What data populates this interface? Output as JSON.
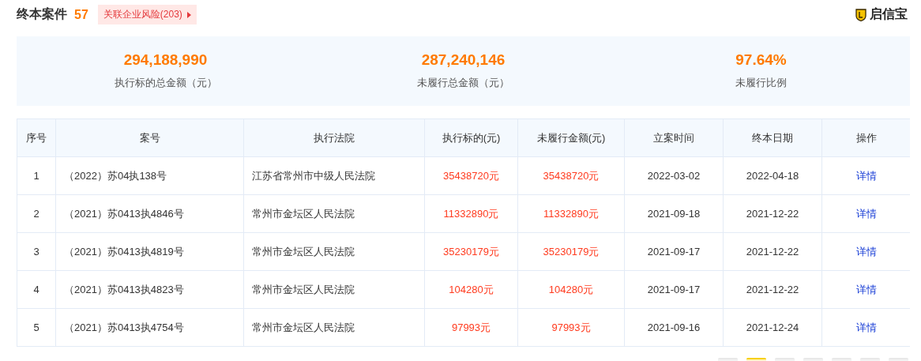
{
  "header": {
    "title": "终本案件",
    "count": "57",
    "risk_tag": "关联企业风险(203)",
    "brand": "启信宝"
  },
  "summary": [
    {
      "value": "294,188,990",
      "label": "执行标的总金额（元）"
    },
    {
      "value": "287,240,146",
      "label": "未履行总金额（元）"
    },
    {
      "value": "97.64%",
      "label": "未履行比例"
    }
  ],
  "table": {
    "columns": [
      "序号",
      "案号",
      "执行法院",
      "执行标的(元)",
      "未履行金额(元)",
      "立案时间",
      "终本日期",
      "操作"
    ],
    "rows": [
      {
        "index": "1",
        "case_no": "（2022）苏04执138号",
        "court": "江苏省常州市中级人民法院",
        "amount": "35438720元",
        "unpaid": "35438720元",
        "filed": "2022-03-02",
        "closed": "2022-04-18",
        "action": "详情"
      },
      {
        "index": "2",
        "case_no": "（2021）苏0413执4846号",
        "court": "常州市金坛区人民法院",
        "amount": "11332890元",
        "unpaid": "11332890元",
        "filed": "2021-09-18",
        "closed": "2021-12-22",
        "action": "详情"
      },
      {
        "index": "3",
        "case_no": "（2021）苏0413执4819号",
        "court": "常州市金坛区人民法院",
        "amount": "35230179元",
        "unpaid": "35230179元",
        "filed": "2021-09-17",
        "closed": "2021-12-22",
        "action": "详情"
      },
      {
        "index": "4",
        "case_no": "（2021）苏0413执4823号",
        "court": "常州市金坛区人民法院",
        "amount": "104280元",
        "unpaid": "104280元",
        "filed": "2021-09-17",
        "closed": "2021-12-22",
        "action": "详情"
      },
      {
        "index": "5",
        "case_no": "（2021）苏0413执4754号",
        "court": "常州市金坛区人民法院",
        "amount": "97993元",
        "unpaid": "97993元",
        "filed": "2021-09-16",
        "closed": "2021-12-24",
        "action": "详情"
      }
    ]
  },
  "pagination": [
    {
      "selected": false
    },
    {
      "selected": true
    },
    {
      "selected": false
    },
    {
      "selected": false
    },
    {
      "selected": false
    },
    {
      "selected": false
    },
    {
      "selected": false
    }
  ]
}
